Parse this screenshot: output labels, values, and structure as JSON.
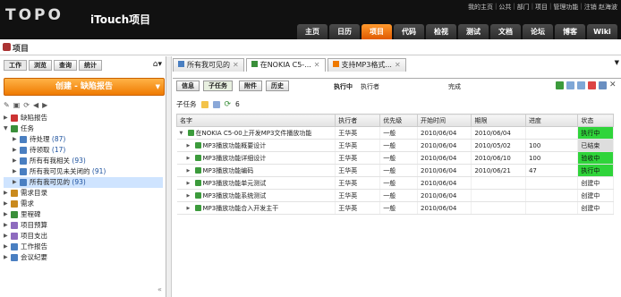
{
  "colors": {
    "accent": "#ef7a00",
    "header_bg": "#111111",
    "green": "#2fd43a"
  },
  "header": {
    "logo": "TOPO",
    "brand": "iTouch项目",
    "top_links": [
      "我的主页",
      "公共",
      "部门",
      "项目",
      "管理功能",
      "注销 赵海波"
    ],
    "nav": [
      {
        "label": "主页",
        "active": false
      },
      {
        "label": "日历",
        "active": false
      },
      {
        "label": "项目",
        "active": true
      },
      {
        "label": "代码",
        "active": false
      },
      {
        "label": "检视",
        "active": false
      },
      {
        "label": "测试",
        "active": false
      },
      {
        "label": "文档",
        "active": false
      },
      {
        "label": "论坛",
        "active": false
      },
      {
        "label": "博客",
        "active": false
      },
      {
        "label": "Wiki",
        "active": false
      }
    ]
  },
  "project": {
    "title": "项目"
  },
  "left": {
    "tabs": [
      {
        "label": "工作",
        "active": true
      },
      {
        "label": "浏览",
        "active": false
      },
      {
        "label": "查询",
        "active": false
      },
      {
        "label": "统计",
        "active": false
      }
    ],
    "create_label": "创建 - 缺陷报告",
    "tree": [
      {
        "label": "缺陷报告",
        "count": "",
        "level": 0,
        "arrow": "▶",
        "icon": "bug-icon",
        "color": "#cc3333",
        "selected": false
      },
      {
        "label": "任务",
        "count": "",
        "level": 0,
        "arrow": "▼",
        "icon": "task-icon",
        "color": "#3a8f3a",
        "selected": false
      },
      {
        "label": "待处理",
        "count": "(87)",
        "level": 1,
        "arrow": "▶",
        "icon": "folder-icon",
        "color": "#4a7fc1",
        "selected": false
      },
      {
        "label": "待领取",
        "count": "(17)",
        "level": 1,
        "arrow": "▶",
        "icon": "folder-icon",
        "color": "#4a7fc1",
        "selected": false
      },
      {
        "label": "所有有我相关",
        "count": "(93)",
        "level": 1,
        "arrow": "▶",
        "icon": "folder-icon",
        "color": "#4a7fc1",
        "selected": false
      },
      {
        "label": "所有我可见未关闭的",
        "count": "(91)",
        "level": 1,
        "arrow": "▶",
        "icon": "folder-icon",
        "color": "#4a7fc1",
        "selected": false
      },
      {
        "label": "所有我可见的",
        "count": "(93)",
        "level": 1,
        "arrow": "▶",
        "icon": "folder-icon",
        "color": "#4a7fc1",
        "selected": true
      },
      {
        "label": "需求目录",
        "count": "",
        "level": 0,
        "arrow": "▶",
        "icon": "catalog-icon",
        "color": "#c98a1e",
        "selected": false
      },
      {
        "label": "需求",
        "count": "",
        "level": 0,
        "arrow": "▶",
        "icon": "requirement-icon",
        "color": "#c98a1e",
        "selected": false
      },
      {
        "label": "里程碑",
        "count": "",
        "level": 0,
        "arrow": "▶",
        "icon": "milestone-icon",
        "color": "#3a8f3a",
        "selected": false
      },
      {
        "label": "项目预算",
        "count": "",
        "level": 0,
        "arrow": "▶",
        "icon": "budget-icon",
        "color": "#8e6bbf",
        "selected": false
      },
      {
        "label": "项目支出",
        "count": "",
        "level": 0,
        "arrow": "▶",
        "icon": "expense-icon",
        "color": "#8e6bbf",
        "selected": false
      },
      {
        "label": "工作报告",
        "count": "",
        "level": 0,
        "arrow": "▶",
        "icon": "report-icon",
        "color": "#4a7fc1",
        "selected": false
      },
      {
        "label": "会议纪要",
        "count": "",
        "level": 0,
        "arrow": "▶",
        "icon": "minutes-icon",
        "color": "#4a7fc1",
        "selected": false
      }
    ]
  },
  "right": {
    "doc_tabs": [
      {
        "label": "所有我可见的",
        "active": false
      },
      {
        "label": "在NOKIA C5-...",
        "active": true
      },
      {
        "label": "支持MP3格式...",
        "active": false
      }
    ],
    "sub_tabs": [
      "信息",
      "子任务",
      "附件",
      "历史"
    ],
    "active_sub_tab": "子任务",
    "flow": {
      "state": "执行中",
      "role": "执行者",
      "next": "完成"
    },
    "subtask_label": "子任务",
    "subtask_count": "6",
    "columns": [
      "名字",
      "执行者",
      "优先级",
      "开始时间",
      "期限",
      "进度",
      "状态"
    ],
    "rows": [
      {
        "name": "在NOKIA C5-00上开发MP3文件播放功能",
        "indent": 0,
        "toggle": "▼",
        "assignee": "王华英",
        "priority": "一般",
        "start": "2010/06/04",
        "due": "2010/06/04",
        "progress": "",
        "status": "执行中",
        "status_class": "status-green"
      },
      {
        "name": "MP3播放功能概要设计",
        "indent": 1,
        "toggle": "▶",
        "assignee": "王华英",
        "priority": "一般",
        "start": "2010/06/04",
        "due": "2010/05/02",
        "progress": "100",
        "status": "已结束",
        "status_class": "status-done"
      },
      {
        "name": "MP3播放功能详细设计",
        "indent": 1,
        "toggle": "▶",
        "assignee": "王华英",
        "priority": "一般",
        "start": "2010/06/04",
        "due": "2010/06/10",
        "progress": "100",
        "status": "验收中",
        "status_class": "status-green"
      },
      {
        "name": "MP3播放功能编码",
        "indent": 1,
        "toggle": "▶",
        "assignee": "王华英",
        "priority": "一般",
        "start": "2010/06/04",
        "due": "2010/06/21",
        "progress": "47",
        "status": "执行中",
        "status_class": "status-green"
      },
      {
        "name": "MP3播放功能单元测试",
        "indent": 1,
        "toggle": "▶",
        "assignee": "王华英",
        "priority": "一般",
        "start": "2010/06/04",
        "due": "",
        "progress": "",
        "status": "创建中",
        "status_class": "status-new"
      },
      {
        "name": "MP3播放功能系统测试",
        "indent": 1,
        "toggle": "▶",
        "assignee": "王华英",
        "priority": "一般",
        "start": "2010/06/04",
        "due": "",
        "progress": "",
        "status": "创建中",
        "status_class": "status-new"
      },
      {
        "name": "MP3播放功能合入开发主干",
        "indent": 1,
        "toggle": "▶",
        "assignee": "王华英",
        "priority": "一般",
        "start": "2010/06/04",
        "due": "",
        "progress": "",
        "status": "创建中",
        "status_class": "status-new"
      }
    ]
  }
}
